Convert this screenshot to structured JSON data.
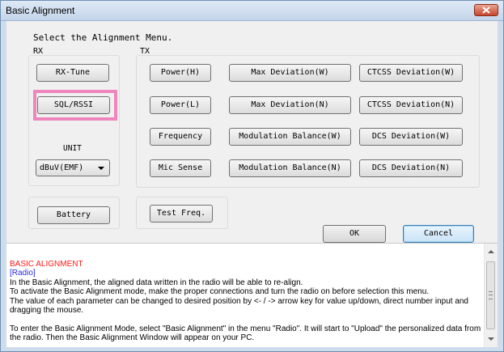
{
  "window": {
    "title": "Basic Alignment",
    "close_icon": "close-x-icon"
  },
  "heading": "Select the Alignment Menu.",
  "rx": {
    "label": "RX",
    "buttons": [
      "RX-Tune",
      "SQL/RSSI"
    ],
    "unit_label": "UNIT",
    "unit_value": "dBuV(EMF)"
  },
  "tx": {
    "label": "TX",
    "buttons": [
      [
        "Power(H)",
        "Max Deviation(W)",
        "CTCSS Deviation(W)"
      ],
      [
        "Power(L)",
        "Max Deviation(N)",
        "CTCSS Deviation(N)"
      ],
      [
        "Frequency",
        "Modulation Balance(W)",
        "DCS Deviation(W)"
      ],
      [
        "Mic Sense",
        "Modulation Balance(N)",
        "DCS Deviation(N)"
      ]
    ]
  },
  "battery_label": "Battery",
  "test_freq_label": "Test Freq.",
  "ok_label": "OK",
  "cancel_label": "Cancel",
  "highlight_color": "#ee86bd",
  "help": {
    "title": "BASIC ALIGNMENT",
    "section": "[Radio]",
    "paragraphs": [
      "In the Basic Alignment, the aligned data written in the radio will be able to re-align.",
      "To activate the Basic Alignment mode, make the proper connections and turn the radio on before selection this menu.",
      "The value of each parameter can be changed to desired position by <- / -> arrow key for value up/down, direct number input and dragging the mouse.",
      "To enter the Basic Alignment Mode, select \"Basic Alignment\" in the menu \"Radio\". It will start to \"Upload\" the personalized data from the radio. Then the Basic Alignment Window will appear on your PC."
    ]
  }
}
